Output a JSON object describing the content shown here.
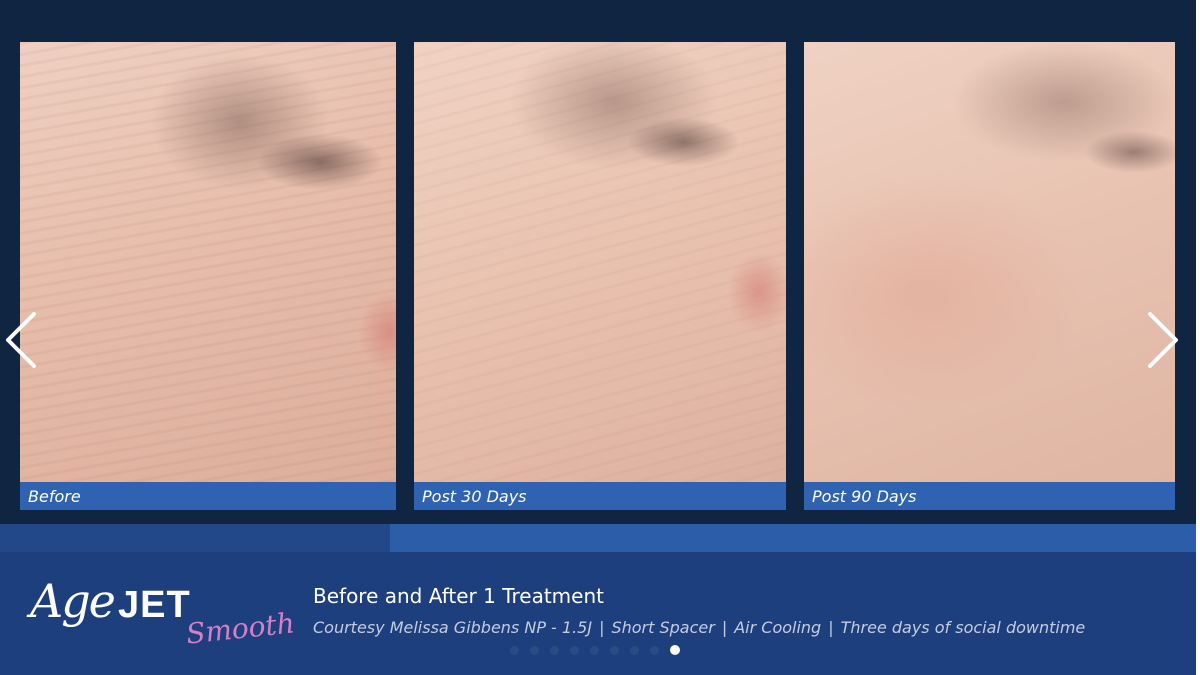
{
  "panels": [
    {
      "caption": "Before"
    },
    {
      "caption": "Post 30 Days"
    },
    {
      "caption": "Post 90 Days"
    }
  ],
  "nav": {
    "prev_icon": "chevron-left-icon",
    "next_icon": "chevron-right-icon"
  },
  "logo": {
    "age": "Age",
    "jet": "JET",
    "smooth": "Smooth"
  },
  "info": {
    "title": "Before and After 1 Treatment",
    "details": [
      "Courtesy Melissa Gibbens NP - 1.5J",
      "Short Spacer",
      "Air Cooling",
      "Three days of social downtime"
    ],
    "separator": "|"
  },
  "pagination": {
    "total": 9,
    "active": 9
  },
  "colors": {
    "background": "#0d2240",
    "caption_bar": "#2f62b0",
    "footer": "#1e3f7d",
    "logo_accent": "#d57fc9"
  }
}
